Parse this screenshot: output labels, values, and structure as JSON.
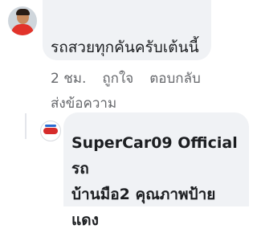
{
  "comment1": {
    "text": "รถสวยทุกคันครับเต้นนี้"
  },
  "actions": {
    "time": "2 ชม.",
    "like": "ถูกใจ",
    "reply": "ตอบกลับ",
    "message": "ส่งข้อความ"
  },
  "comment2": {
    "author": "SuperCar09 Official",
    "text_line1": "รถ",
    "text_line2": "บ้านมือ2 คุณภาพป้าย",
    "text_line3": "แดง"
  }
}
